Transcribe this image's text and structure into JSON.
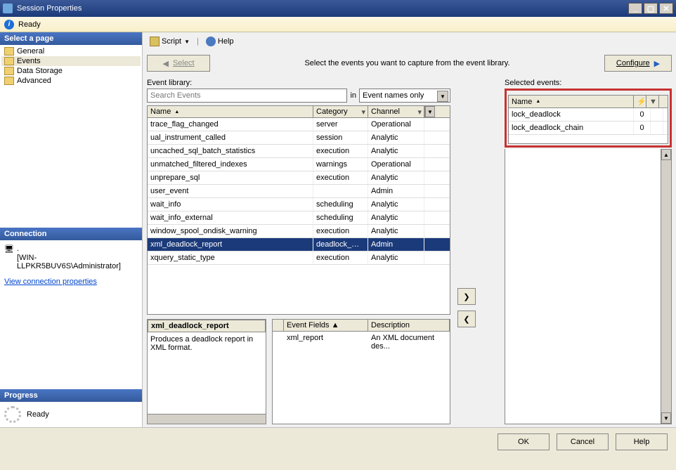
{
  "window": {
    "title": "Session Properties"
  },
  "status": {
    "text": "Ready"
  },
  "sidebar": {
    "header": "Select a page",
    "items": [
      "General",
      "Events",
      "Data Storage",
      "Advanced"
    ],
    "selected_index": 1
  },
  "connection": {
    "header": "Connection",
    "text": "[WIN-LLPKR5BUV6S\\Administrator]",
    "link": "View connection properties"
  },
  "progress": {
    "header": "Progress",
    "text": "Ready"
  },
  "toolbar": {
    "script": "Script",
    "help": "Help"
  },
  "wizard": {
    "back": "Select",
    "caption": "Select the events you want to capture from the event library.",
    "configure": "Configure"
  },
  "library": {
    "label": "Event library:",
    "search_placeholder": "Search Events",
    "scope_label": "in",
    "scope_value": "Event names only",
    "columns": {
      "name": "Name",
      "category": "Category",
      "channel": "Channel"
    },
    "rows": [
      {
        "name": "trace_flag_changed",
        "category": "server",
        "channel": "Operational"
      },
      {
        "name": "ual_instrument_called",
        "category": "session",
        "channel": "Analytic"
      },
      {
        "name": "uncached_sql_batch_statistics",
        "category": "execution",
        "channel": "Analytic"
      },
      {
        "name": "unmatched_filtered_indexes",
        "category": "warnings",
        "channel": "Operational"
      },
      {
        "name": "unprepare_sql",
        "category": "execution",
        "channel": "Analytic"
      },
      {
        "name": "user_event",
        "category": "",
        "channel": "Admin"
      },
      {
        "name": "wait_info",
        "category": "scheduling",
        "channel": "Analytic"
      },
      {
        "name": "wait_info_external",
        "category": "scheduling",
        "channel": "Analytic"
      },
      {
        "name": "window_spool_ondisk_warning",
        "category": "execution",
        "channel": "Analytic"
      },
      {
        "name": "xml_deadlock_report",
        "category": "deadlock_mo...",
        "channel": "Admin"
      },
      {
        "name": "xquery_static_type",
        "category": "execution",
        "channel": "Analytic"
      }
    ],
    "selected_index": 9
  },
  "selected": {
    "label": "Selected events:",
    "col_name": "Name",
    "rows": [
      {
        "name": "lock_deadlock",
        "v": "0"
      },
      {
        "name": "lock_deadlock_chain",
        "v": "0"
      }
    ]
  },
  "description": {
    "title": "xml_deadlock_report",
    "text": "Produces a deadlock report in XML format."
  },
  "fields": {
    "col_field": "Event Fields",
    "col_desc": "Description",
    "rows": [
      {
        "field": "xml_report",
        "desc": "An XML document des..."
      }
    ]
  },
  "buttons": {
    "ok": "OK",
    "cancel": "Cancel",
    "help": "Help"
  }
}
